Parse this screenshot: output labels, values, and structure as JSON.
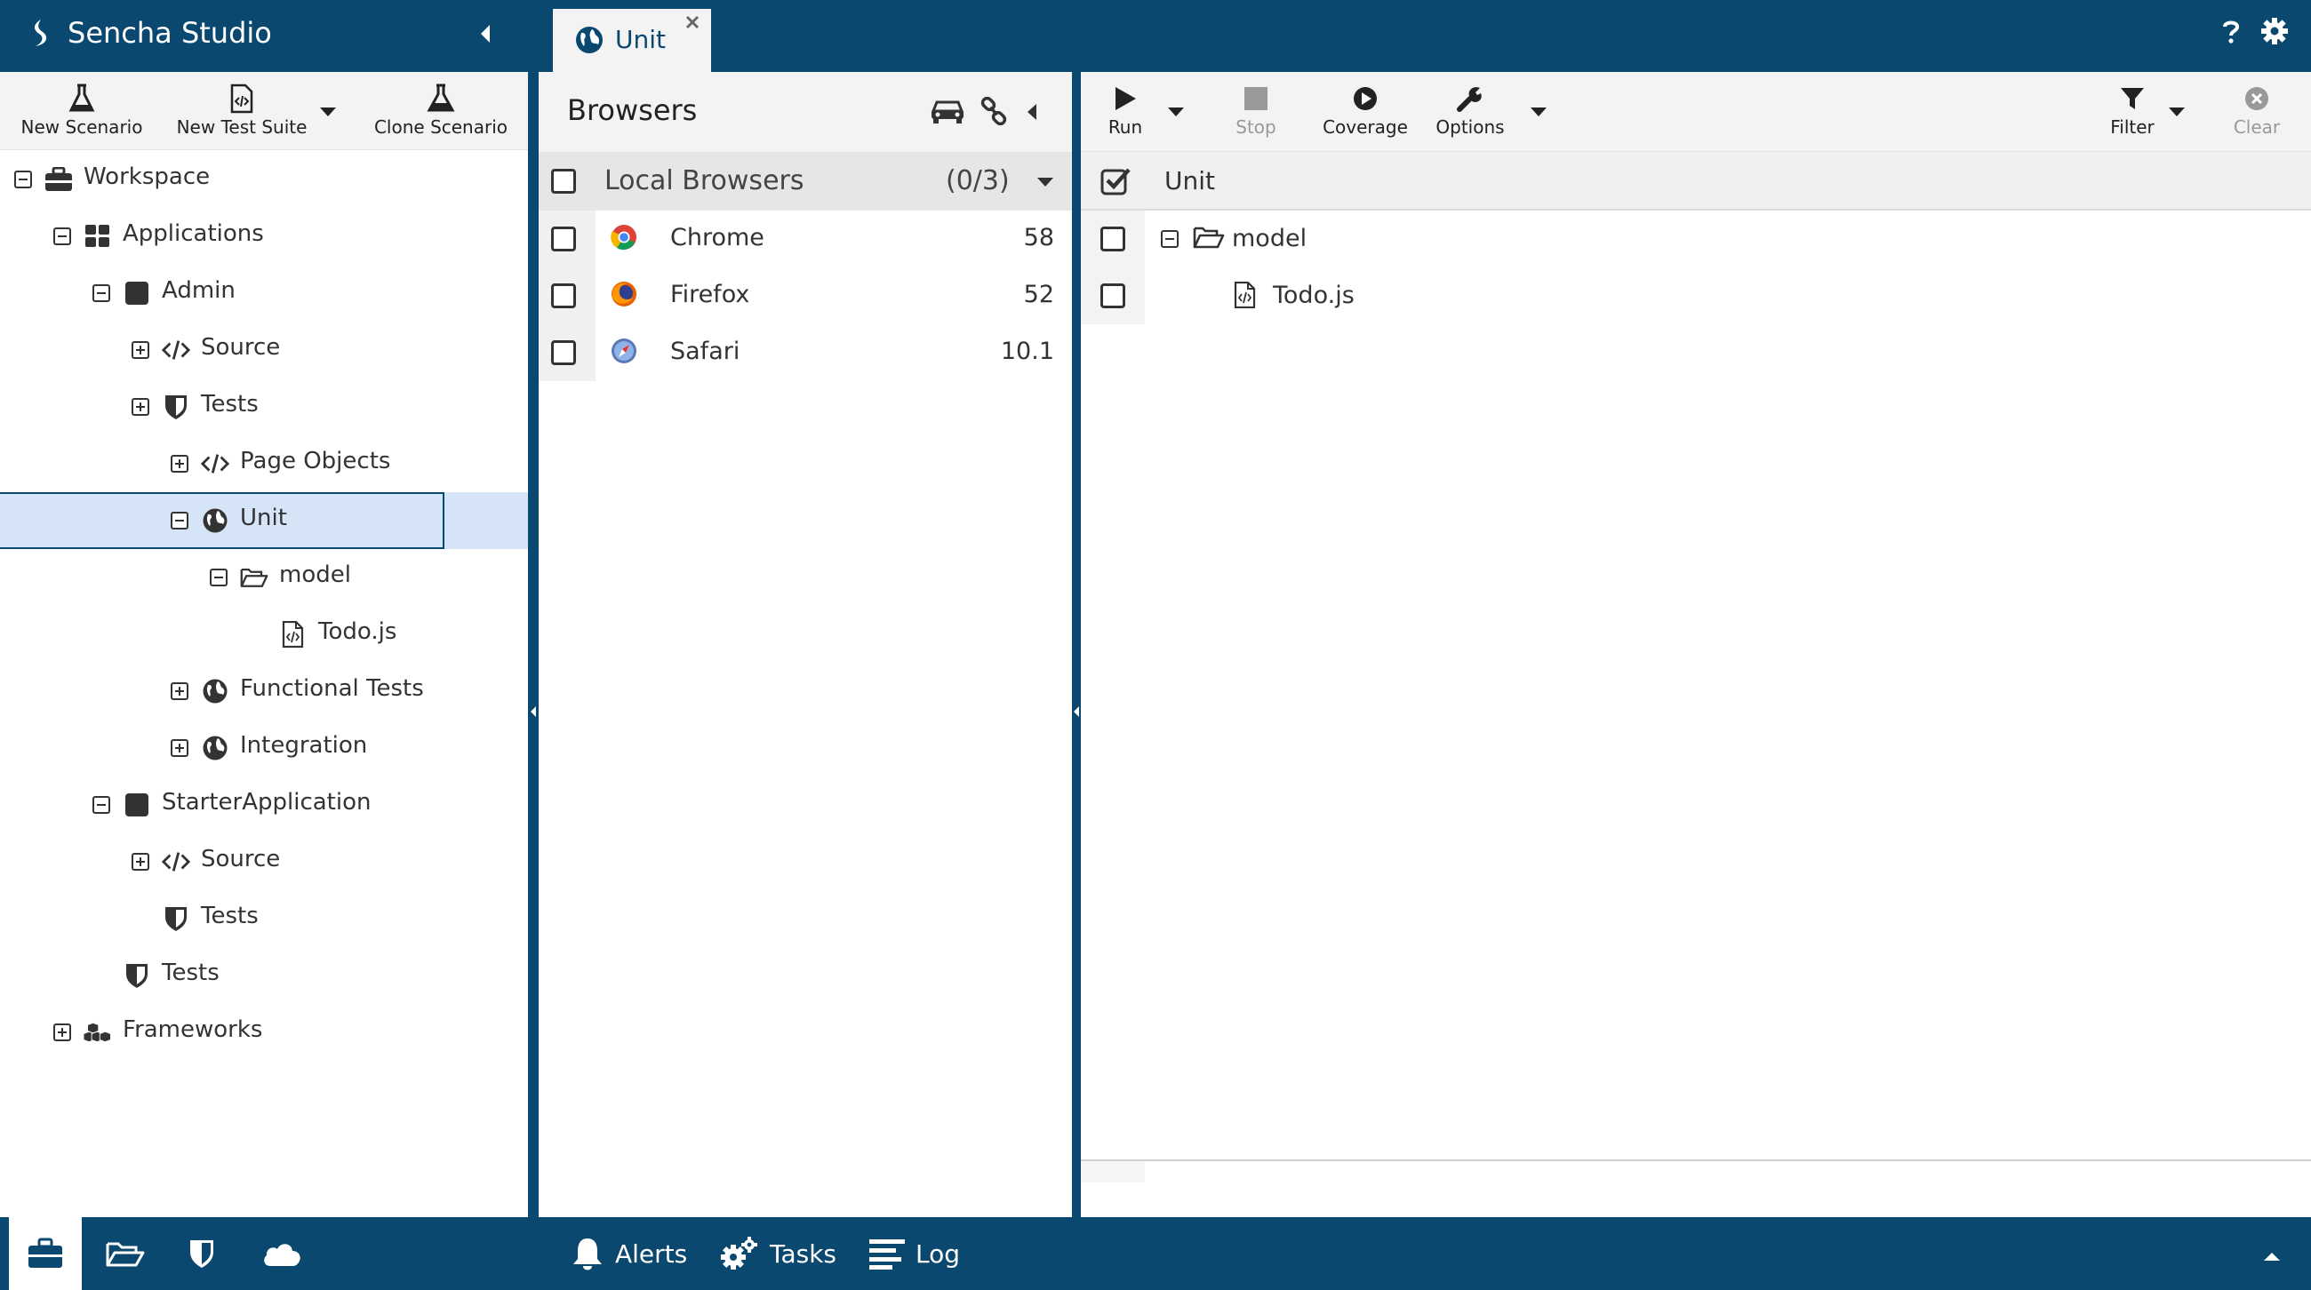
{
  "app": {
    "title": "Sencha Studio"
  },
  "left_toolbar": {
    "new_scenario": "New Scenario",
    "new_test_suite": "New Test Suite",
    "clone_scenario": "Clone Scenario"
  },
  "tree": [
    {
      "label": "Workspace",
      "depth": 0,
      "expander": "minus",
      "icon": "briefcase-icon"
    },
    {
      "label": "Applications",
      "depth": 1,
      "expander": "minus",
      "icon": "grid-icon"
    },
    {
      "label": "Admin",
      "depth": 2,
      "expander": "minus",
      "icon": "square-icon"
    },
    {
      "label": "Source",
      "depth": 3,
      "expander": "plus",
      "icon": "code-icon"
    },
    {
      "label": "Tests",
      "depth": 3,
      "expander": "plus",
      "icon": "shield-icon"
    },
    {
      "label": "Page Objects",
      "depth": 4,
      "expander": "plus",
      "icon": "code-icon"
    },
    {
      "label": "Unit",
      "depth": 4,
      "expander": "minus",
      "icon": "globe-icon",
      "selected": true
    },
    {
      "label": "model",
      "depth": 5,
      "expander": "minus",
      "icon": "folder-open-icon"
    },
    {
      "label": "Todo.js",
      "depth": 6,
      "expander": "none",
      "icon": "file-code-icon"
    },
    {
      "label": "Functional Tests",
      "depth": 4,
      "expander": "plus",
      "icon": "globe-icon"
    },
    {
      "label": "Integration",
      "depth": 4,
      "expander": "plus",
      "icon": "globe-icon"
    },
    {
      "label": "StarterApplication",
      "depth": 2,
      "expander": "minus",
      "icon": "square-icon"
    },
    {
      "label": "Source",
      "depth": 3,
      "expander": "plus",
      "icon": "code-icon"
    },
    {
      "label": "Tests",
      "depth": 3,
      "expander": "none",
      "icon": "shield-icon"
    },
    {
      "label": "Tests",
      "depth": 2,
      "expander": "none",
      "icon": "shield-icon"
    },
    {
      "label": "Frameworks",
      "depth": 1,
      "expander": "plus",
      "icon": "cubes-icon"
    }
  ],
  "document_tab": {
    "label": "Unit"
  },
  "browsers": {
    "title": "Browsers",
    "group_label": "Local Browsers",
    "group_count": "(0/3)",
    "items": [
      {
        "name": "Chrome",
        "version": "58",
        "icon": "chrome-icon"
      },
      {
        "name": "Firefox",
        "version": "52",
        "icon": "firefox-icon"
      },
      {
        "name": "Safari",
        "version": "10.1",
        "icon": "safari-icon"
      }
    ]
  },
  "right_toolbar": {
    "run": "Run",
    "stop": "Stop",
    "coverage": "Coverage",
    "options": "Options",
    "filter": "Filter",
    "clear": "Clear"
  },
  "suite": {
    "header": "Unit",
    "rows": [
      {
        "label": "model",
        "icon": "folder-open-icon",
        "expander": "minus"
      },
      {
        "label": "Todo.js",
        "icon": "file-code-icon",
        "expander": "none"
      }
    ]
  },
  "bottom_bar": {
    "alerts": "Alerts",
    "tasks": "Tasks",
    "log": "Log"
  },
  "colors": {
    "primary": "#0b4870",
    "selection": "#d5e5f7",
    "toolbar": "#f3f3f3"
  }
}
